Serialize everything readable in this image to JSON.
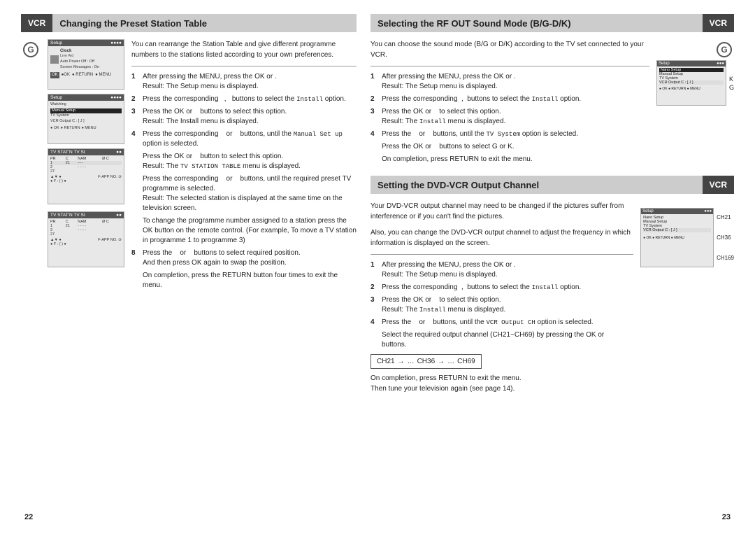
{
  "left": {
    "header": {
      "vcr": "VCR",
      "title": "Changing the Preset Station Table"
    },
    "intro": "You can rearrange the Station Table and give different programme numbers to the stations listed according to your own preferences.",
    "steps": [
      {
        "num": "1",
        "text": "After pressing the MENU, press the OK or .",
        "result": "Result:",
        "result_text": "The Setup menu is displayed."
      },
      {
        "num": "2",
        "text": "Press the corresponding      ,      buttons to select the Install option."
      },
      {
        "num": "3",
        "text": "Press the OK or      buttons to select this option.",
        "result": "Result:",
        "result_text": "The Install menu is displayed."
      },
      {
        "num": "4",
        "text": "Press the corresponding      or      buttons, until the Manual Set up option is selected."
      },
      {
        "num": "",
        "text": "Press the OK or      button to select this option.",
        "result": "Result:",
        "result_text": "The TV STATION TABLE menu is displayed."
      },
      {
        "num": "",
        "text": "Press the corresponding      or      buttons, until the required preset TV programme is selected.",
        "result": "Result:",
        "result_text": "The selected station is displayed at the same time on the television screen."
      },
      {
        "num": "",
        "text": "To change the programme number assigned to a station press the OK button on the remote control. (For example, To move a TV station in programme 1 to programme 3)"
      },
      {
        "num": "8",
        "text": "Press the      or      buttons to select required position. And then press OK again to swap the position."
      },
      {
        "num": "",
        "text": "On completion, press the RETURN button four times to exit the menu."
      }
    ],
    "page_num": "22"
  },
  "right": {
    "sections": [
      {
        "header": {
          "vcr": "VCR",
          "title": "Selecting the RF OUT Sound Mode (B/G-D/K)"
        },
        "intro": "You can choose the sound mode (B/G or D/K) according to the TV set connected to your VCR.",
        "steps": [
          {
            "num": "1",
            "text": "After pressing the MENU, press the OK or .",
            "result": "Result:",
            "result_text": "The Setup menu is displayed."
          },
          {
            "num": "2",
            "text": "Press the corresponding      ,      buttons to select the Install option."
          },
          {
            "num": "3",
            "text": "Press the OK or      to select this option.",
            "result": "Result:",
            "result_text": "The Install menu is displayed."
          },
          {
            "num": "4",
            "text": "Press the      or      buttons, until the TV System option is selected."
          },
          {
            "num": "",
            "text": "Press the OK or      buttons to select G or K."
          },
          {
            "num": "",
            "text": "On completion, press RETURN to exit the menu."
          }
        ],
        "kg": [
          "K",
          "G"
        ]
      },
      {
        "header": {
          "vcr": "VCR",
          "title": "Setting the DVD-VCR Output Channel"
        },
        "intro1": "Your DVD-VCR output channel may need to be changed if the pictures suffer from interference or if you can't find the pictures.",
        "intro2": "Also, you can change the DVD-VCR output channel to adjust the frequency in which information is displayed on the screen.",
        "steps": [
          {
            "num": "1",
            "text": "After pressing the MENU, press the OK or .",
            "result": "Result:",
            "result_text": "The Setup menu is displayed."
          },
          {
            "num": "2",
            "text": "Press the corresponding      ,      buttons to select the Install option."
          },
          {
            "num": "3",
            "text": "Press the OK or      to select this option.",
            "result": "Result:",
            "result_text": "The Install menu is displayed."
          },
          {
            "num": "4",
            "text": "Press the      or      buttons, until the VCR Output CH option is selected."
          },
          {
            "num": "",
            "text": "Select the required output channel (CH21~CH69) by pressing the OK or      buttons."
          }
        ],
        "channel_diagram": {
          "ch21": "CH21",
          "arrow1": "→",
          "dots1": "…",
          "ch36": "CH36",
          "arrow2": "→",
          "dots2": "…",
          "ch69": "CH69"
        },
        "closing": "On completion, press RETURN to exit the menu.\nThen tune your television again (see page 14).",
        "ch_labels": [
          "CH21",
          "CH36",
          "CH169"
        ]
      }
    ],
    "page_num": "23"
  }
}
